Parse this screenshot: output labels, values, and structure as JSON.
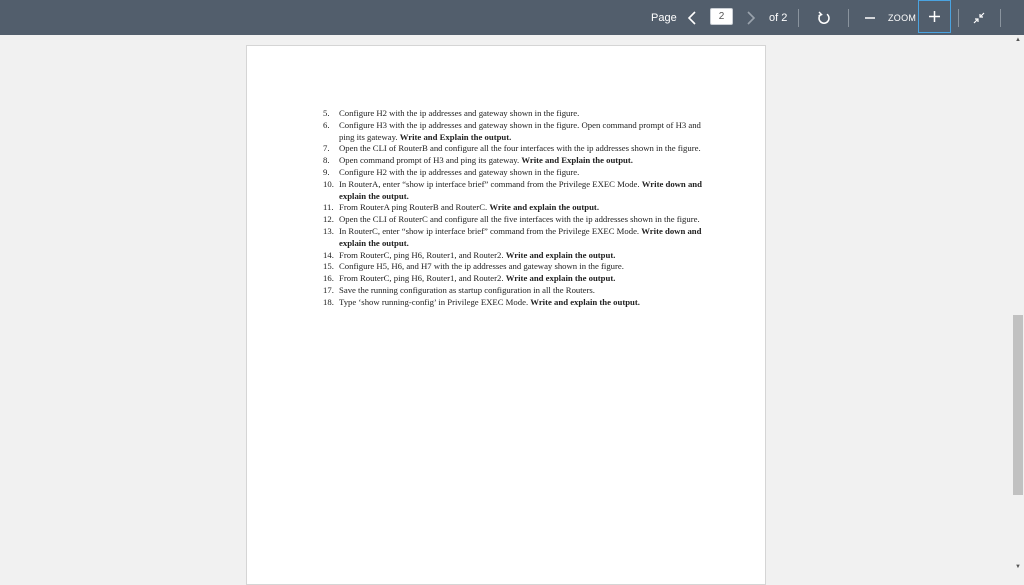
{
  "toolbar": {
    "page_label": "Page",
    "current_page": "2",
    "of_label": "of 2",
    "zoom_label": "ZOOM",
    "prev_icon": "chevron-left-icon",
    "next_icon": "chevron-right-icon",
    "rotate_icon": "rotate-icon",
    "zoom_out_icon": "minus-icon",
    "zoom_in_icon": "plus-icon",
    "fit_icon": "collapse-icon",
    "accent_color": "#4aa3e0",
    "bar_color": "#525e6c"
  },
  "document": {
    "items": [
      {
        "num": "5.",
        "text": "Configure H2 with the ip addresses and gateway shown in the figure.",
        "bold": ""
      },
      {
        "num": "6.",
        "text": "Configure H3 with the ip addresses and gateway shown in the figure. Open command prompt of H3 and ping its gateway. ",
        "bold": "Write and Explain the output."
      },
      {
        "num": "7.",
        "text": "Open the CLI of RouterB and configure all the four interfaces with the ip addresses shown in the figure.",
        "bold": ""
      },
      {
        "num": "8.",
        "text": "Open command prompt of H3 and ping its gateway. ",
        "bold": "Write and Explain the output."
      },
      {
        "num": "9.",
        "text": "Configure H2 with the ip addresses and gateway shown in the figure.",
        "bold": ""
      },
      {
        "num": "10.",
        "text": "In RouterA, enter “show ip interface brief” command from the Privilege EXEC Mode. ",
        "bold": "Write down and explain the output."
      },
      {
        "num": "11.",
        "text": "From RouterA ping RouterB and RouterC. ",
        "bold": "Write and explain the output."
      },
      {
        "num": "12.",
        "text": "Open the CLI of RouterC and configure all the five interfaces with the ip addresses shown in the figure.",
        "bold": ""
      },
      {
        "num": "13.",
        "text": "In RouterC, enter “show ip interface brief” command from the Privilege EXEC Mode. ",
        "bold": "Write down and explain the output."
      },
      {
        "num": "14.",
        "text": "From RouterC, ping H6, Router1, and Router2. ",
        "bold": "Write and explain the output."
      },
      {
        "num": "15.",
        "text": "Configure H5, H6, and H7 with the ip addresses and gateway shown in the figure.",
        "bold": ""
      },
      {
        "num": "16.",
        "text": "From RouterC, ping H6, Router1, and Router2. ",
        "bold": "Write and explain the output."
      },
      {
        "num": "17.",
        "text": "Save the running configuration as startup configuration in all the Routers.",
        "bold": ""
      },
      {
        "num": "18.",
        "text": "Type ‘show running-config’ in Privilege EXEC Mode. ",
        "bold": "Write and explain the output."
      }
    ]
  }
}
